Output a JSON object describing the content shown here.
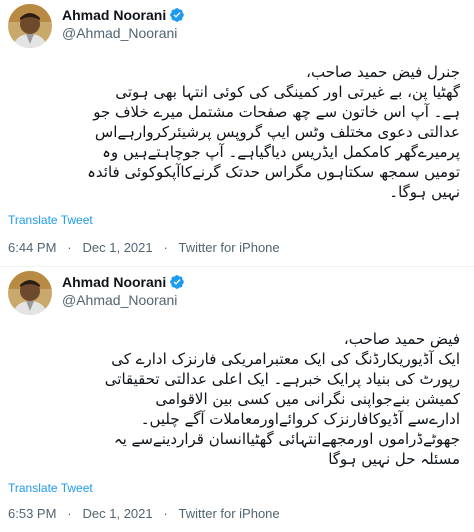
{
  "colors": {
    "accent": "#1d9bf0",
    "text": "#0f1419",
    "muted": "#536471"
  },
  "tweets": [
    {
      "author": {
        "name": "Ahmad Noorani",
        "handle": "@Ahmad_Noorani",
        "verified_icon": "verified-badge-icon"
      },
      "lines": [
        "جنرل فیض حمید صاحب،",
        "گھٹیا پن، بے غیرتی اور کمینگی کی کوئی انتہا بھی ہوتی",
        "ہے۔ آپ اس خاتون سے چھ صفحات مشتمل میرے خلاف جو",
        "عدالتی دعوی مختلف وٹس ایپ گروپس پرشیئرکروارہےاس",
        "پرمیرےگھر کامکمل ایڈریس دیاگیاہے۔ آپ جوچاہتےہیں وہ",
        "تومیں سمجھ سکتاہوں مگراس حدتک گرنےکاآپکوکوئی فائدہ",
        "نہیں ہوگا۔"
      ],
      "translate_label": "Translate Tweet",
      "time": "6:44 PM",
      "separator": "·",
      "date": "Dec 1, 2021",
      "source": "Twitter for iPhone"
    },
    {
      "author": {
        "name": "Ahmad Noorani",
        "handle": "@Ahmad_Noorani",
        "verified_icon": "verified-badge-icon"
      },
      "lines": [
        "فیض حمید صاحب،",
        "ایک آڈیوریکارڈنگ کی ایک معتبرامریکی فارنزک ادارے کی",
        "رپورٹ کی بنیاد پرایک خبرہے۔ ایک اعلی عدالتی تحقیقاتی",
        "کمیشن بنےجواپنی نگرانی میں کسی بین الاقوامی",
        "ادارےسے آڈیوکافارنزک کروائےاورمعاملات آگے چلیں۔",
        "جھوٹےڈراموں اورمجھےانتہائی گھٹیاانسان قراردینےسے یہ",
        "مسئلہ حل نہیں ہوگا"
      ],
      "translate_label": "Translate Tweet",
      "time": "6:53 PM",
      "separator": "·",
      "date": "Dec 1, 2021",
      "source": "Twitter for iPhone"
    }
  ]
}
